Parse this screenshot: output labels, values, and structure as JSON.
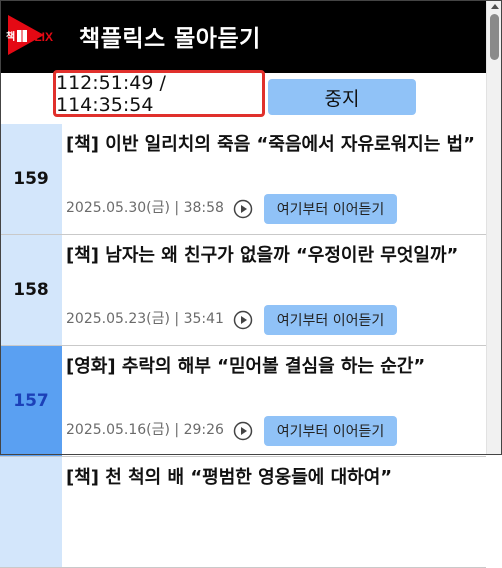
{
  "app": {
    "title": "책플릭스 몰아듣기",
    "logo_text_left": "책",
    "logo_text_right": "FLIX",
    "brand_color": "#e50914"
  },
  "player": {
    "time_display": "112:51:49 / 114:35:54",
    "stop_label": "중지"
  },
  "episodes": [
    {
      "number": "159",
      "title": "[책] 이반 일리치의 죽음 “죽음에서 자유로워지는 법”",
      "meta": "2025.05.30(금) | 38:58",
      "resume_label": "여기부터 이어듣기",
      "active": false
    },
    {
      "number": "158",
      "title": "[책] 남자는 왜 친구가 없을까 “우정이란 무엇일까”",
      "meta": "2025.05.23(금) | 35:41",
      "resume_label": "여기부터 이어듣기",
      "active": false
    },
    {
      "number": "157",
      "title": "[영화] 추락의 해부 “믿어볼 결심을 하는 순간”",
      "meta": "2025.05.16(금) | 29:26",
      "resume_label": "여기부터 이어듣기",
      "active": true
    },
    {
      "number": "",
      "title": "[책] 천 척의 배 “평범한 영웅들에 대하여”",
      "meta": "",
      "resume_label": "",
      "active": false
    }
  ],
  "colors": {
    "header_bg": "#000000",
    "accent_button": "#90c2f7",
    "number_cell": "#d3e6fb",
    "number_cell_active": "#5aa0f2",
    "time_box_border": "#e0302c"
  },
  "icons": {
    "play": "play-circle-icon",
    "logo": "book-flix-logo"
  }
}
